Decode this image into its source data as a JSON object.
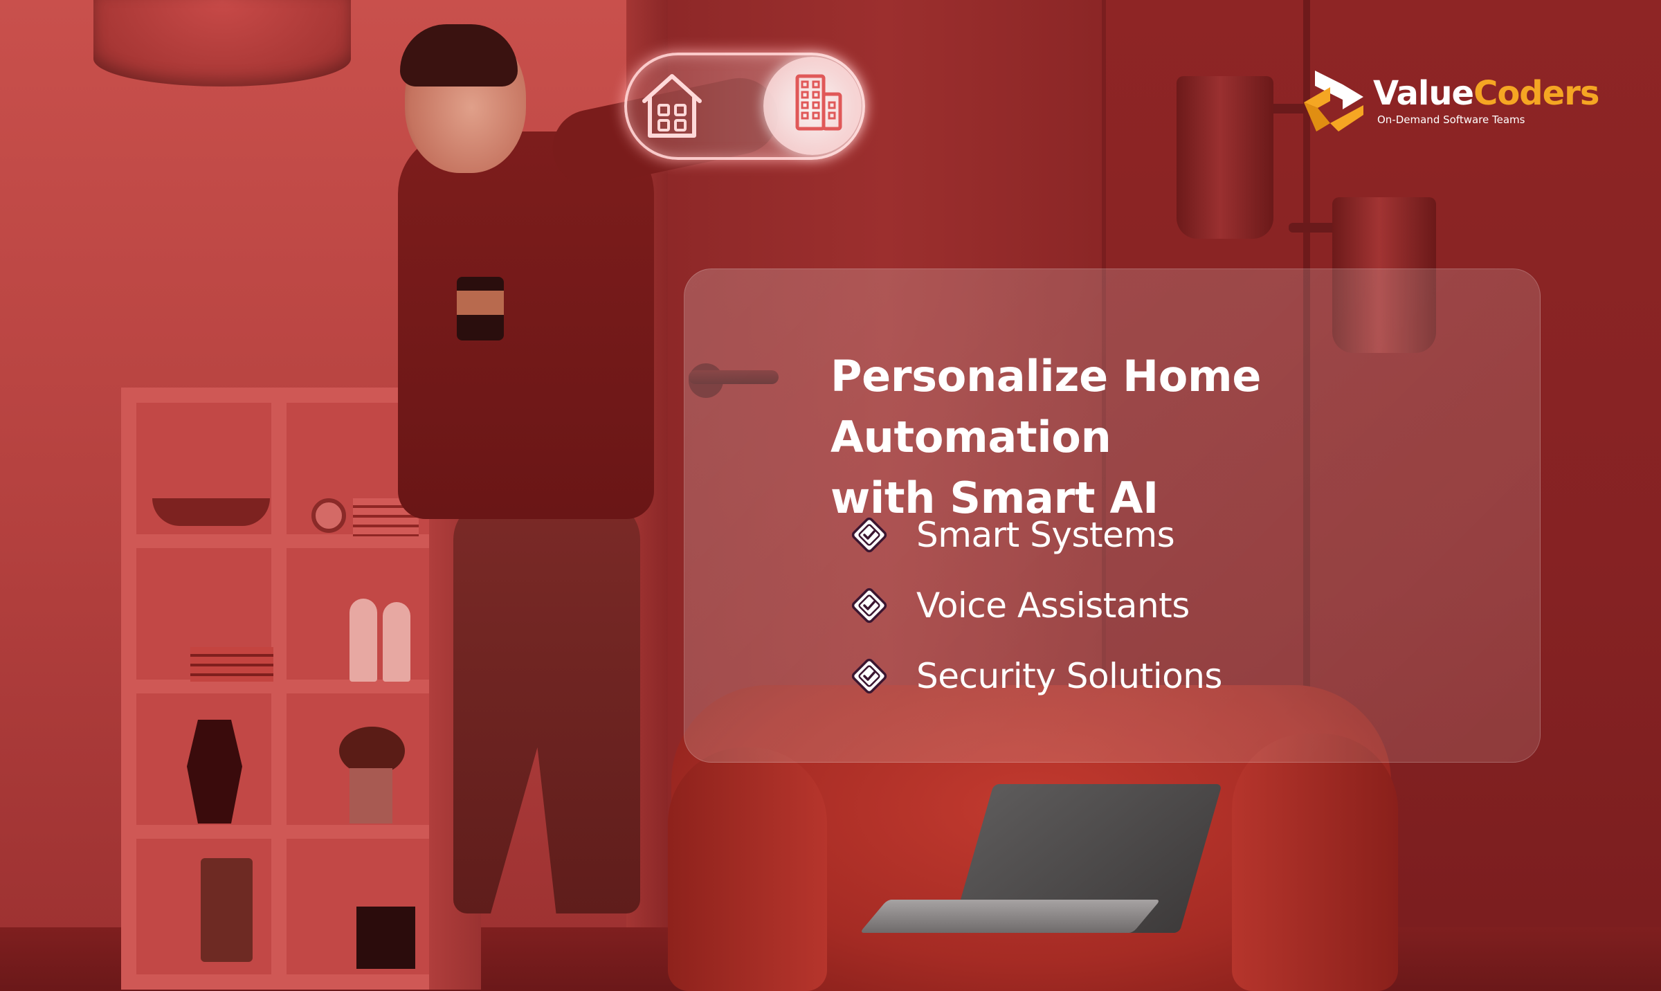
{
  "brand": {
    "name_part1": "Value",
    "name_part2": "Coders",
    "tagline": "On-Demand Software Teams",
    "primary_color": "#ffffff",
    "accent_color": "#f5a623"
  },
  "hero": {
    "title_line1": "Personalize Home Automation",
    "title_line2": "with Smart AI"
  },
  "features": [
    {
      "label": "Smart Systems",
      "icon": "diamond-check-icon"
    },
    {
      "label": "Voice Assistants",
      "icon": "diamond-check-icon"
    },
    {
      "label": "Security Solutions",
      "icon": "diamond-check-icon"
    }
  ],
  "toggle": {
    "left_icon": "house-icon",
    "right_icon": "building-icon",
    "state": "on"
  },
  "colors": {
    "background": "#a53433",
    "glass_card": "rgba(255,255,255,0.16)",
    "text": "#ffffff",
    "icon_border": "#3b1630"
  }
}
